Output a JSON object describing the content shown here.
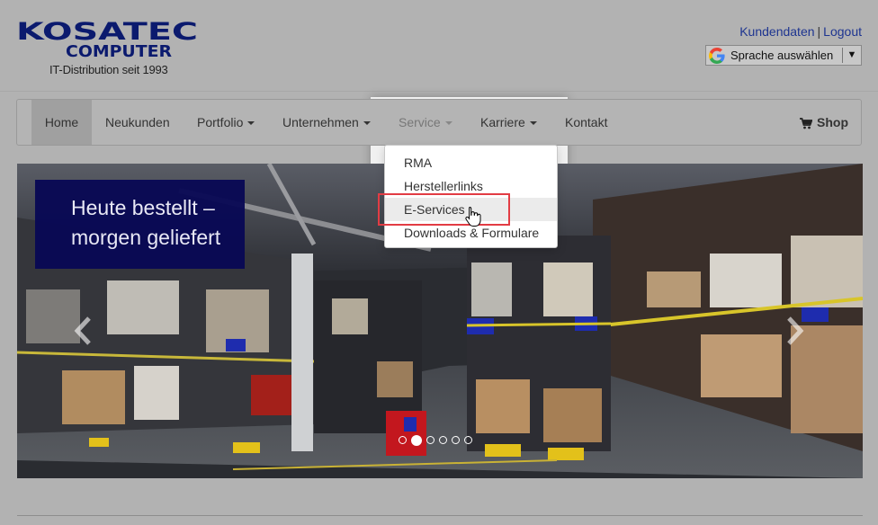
{
  "brand": {
    "line1": "KOSATEC",
    "line2": "COMPUTER",
    "tagline": "IT-Distribution seit 1993",
    "color": "#0b1a6e"
  },
  "toplinks": {
    "customer": "Kundendaten",
    "separator": "|",
    "logout": "Logout"
  },
  "language": {
    "label": "Sprache auswählen",
    "icon": "google-g-icon"
  },
  "nav": {
    "items": [
      {
        "label": "Home",
        "active": true
      },
      {
        "label": "Neukunden"
      },
      {
        "label": "Portfolio",
        "dropdown": true
      },
      {
        "label": "Unternehmen",
        "dropdown": true
      },
      {
        "label": "Service",
        "dropdown": true,
        "open": true
      },
      {
        "label": "Karriere",
        "dropdown": true
      },
      {
        "label": "Kontakt"
      }
    ],
    "shop": {
      "label": "Shop",
      "icon": "cart-icon"
    }
  },
  "service_menu": {
    "items": [
      "RMA",
      "Herstellerlinks",
      "E-Services",
      "Downloads & Formulare"
    ],
    "hovered": "E-Services",
    "highlight_color": "#e23c44"
  },
  "slider": {
    "caption_line1": "Heute bestellt –",
    "caption_line2": "morgen geliefert",
    "caption_bg": "#08085a",
    "indicator_count": 6,
    "active_indicator": 2,
    "prev_icon": "chevron-left-icon",
    "next_icon": "chevron-right-icon"
  }
}
